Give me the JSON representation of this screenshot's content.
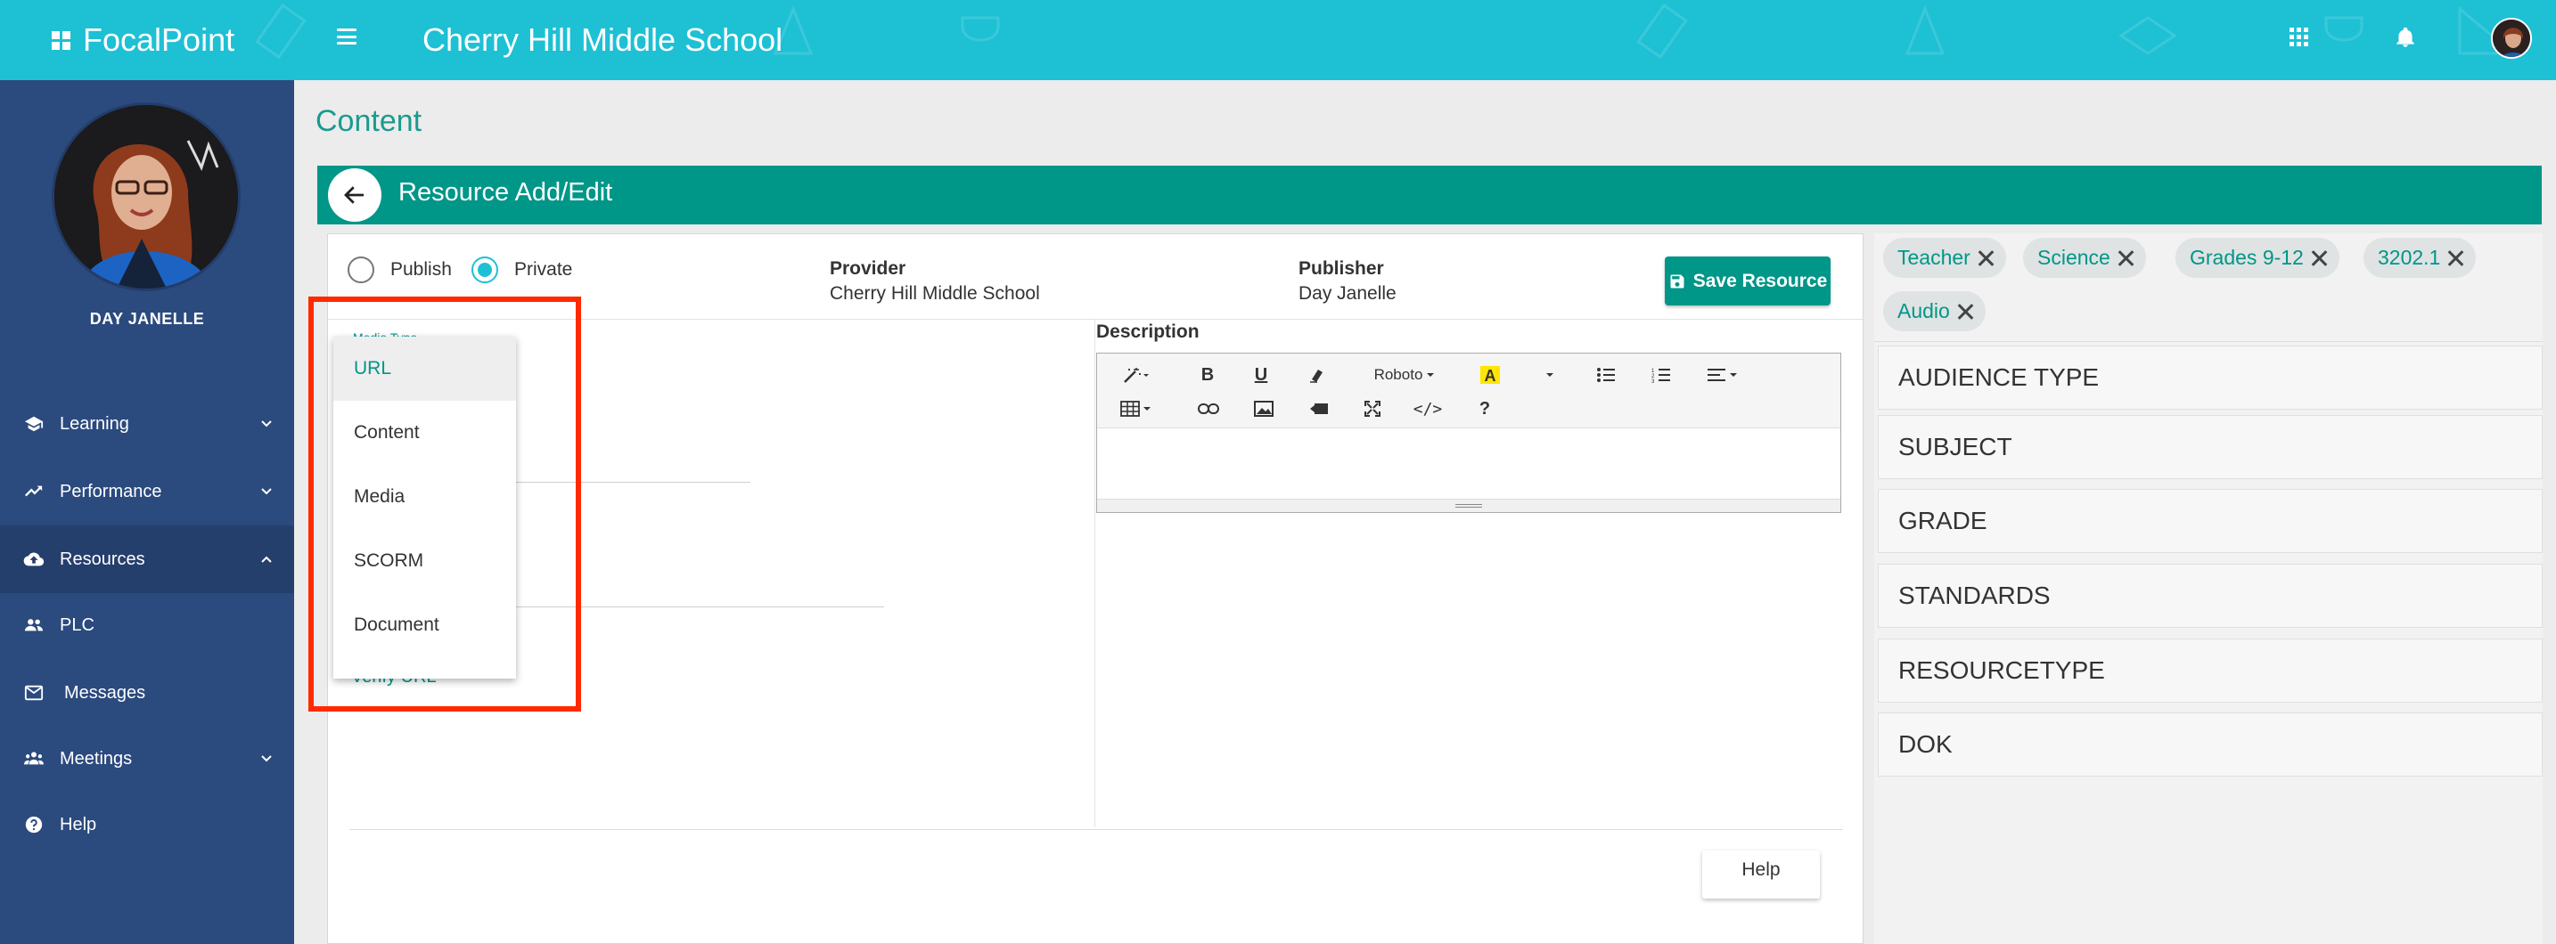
{
  "app": {
    "brand": "FocalPoint",
    "school": "Cherry Hill Middle School"
  },
  "sidebar": {
    "user_name": "DAY JANELLE",
    "items": [
      {
        "label": "Learning",
        "icon": "graduation-cap-icon",
        "chevron": "down"
      },
      {
        "label": "Performance",
        "icon": "trending-up-icon",
        "chevron": "down"
      },
      {
        "label": "Resources",
        "icon": "cloud-upload-icon",
        "chevron": "up"
      },
      {
        "label": "PLC",
        "icon": "people-icon",
        "chevron": null
      },
      {
        "label": "Messages",
        "icon": "mail-icon",
        "chevron": null
      },
      {
        "label": "Meetings",
        "icon": "group-icon",
        "chevron": "down"
      },
      {
        "label": "Help",
        "icon": "help-circle-icon",
        "chevron": null
      }
    ],
    "active_item": "Resources"
  },
  "page": {
    "title": "Content",
    "panel_title": "Resource Add/Edit"
  },
  "form": {
    "visibility_options": [
      "Publish",
      "Private"
    ],
    "visibility_selected": "Private",
    "provider_label": "Provider",
    "provider_value": "Cherry Hill Middle School",
    "publisher_label": "Publisher",
    "publisher_value": "Day Janelle",
    "save_label": "Save Resource",
    "media_type_label": "Media Type",
    "verify_link": "Verify URL",
    "description_label": "Description",
    "help_label": "Help",
    "editor_font": "Roboto"
  },
  "media_type_dropdown": {
    "options": [
      "URL",
      "Content",
      "Media",
      "SCORM",
      "Document"
    ],
    "selected": "URL"
  },
  "tags": [
    "Teacher",
    "Science",
    "Grades 9-12",
    "3202.1",
    "Audio"
  ],
  "facets": [
    "AUDIENCE TYPE",
    "SUBJECT",
    "GRADE",
    "STANDARDS",
    "RESOURCETYPE",
    "DOK"
  ],
  "colors": {
    "topbar": "#1ec0d4",
    "sidebar": "#2b4a7e",
    "primary": "#009688",
    "highlight": "#ff2a00"
  }
}
